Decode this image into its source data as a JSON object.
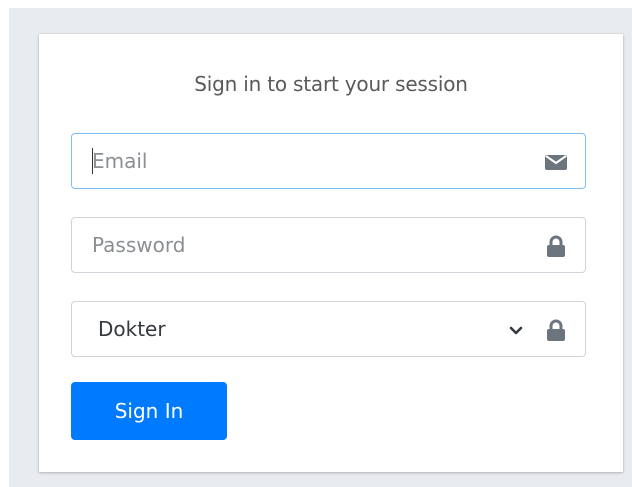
{
  "login": {
    "heading": "Sign in to start your session",
    "email": {
      "value": "",
      "placeholder": "Email"
    },
    "password": {
      "value": "",
      "placeholder": "Password"
    },
    "role": {
      "selected": "Dokter"
    },
    "submit_label": "Sign In"
  },
  "icons": {
    "email": "envelope-icon",
    "password": "lock-icon",
    "role": "lock-icon",
    "dropdown": "chevron-down-icon"
  },
  "colors": {
    "background": "#e9ecef",
    "card": "#ffffff",
    "primary": "#007bff",
    "focus_border": "#80bdff",
    "input_border": "#ced4da",
    "icon": "#6c757d"
  }
}
